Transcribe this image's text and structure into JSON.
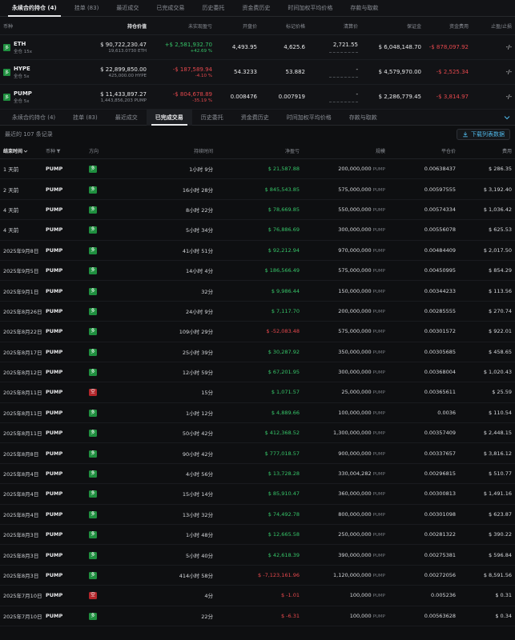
{
  "top_tabs": [
    {
      "label": "永续合约持仓 (4)",
      "active": true
    },
    {
      "label": "挂单 (83)"
    },
    {
      "label": "最近成交"
    },
    {
      "label": "已完成交易"
    },
    {
      "label": "历史委托"
    },
    {
      "label": "资金费历史"
    },
    {
      "label": "时间加权平均价格"
    },
    {
      "label": "存款与取款"
    }
  ],
  "positions": {
    "headers": [
      "币种",
      "持仓价值",
      "未实现盈亏",
      "开盘价",
      "标记价格",
      "清算价",
      "保证金",
      "资金费用",
      "止盈/止损"
    ],
    "rows": [
      {
        "coin": "ETH",
        "mode": "全仓 15x",
        "value": "$ 90,722,230.47",
        "size": "19,613.0730 ETH",
        "pnl": "+$ 2,581,932.70",
        "pnl_pct": "+42.69 %",
        "entry": "4,493.95",
        "mark": "4,625.6",
        "liq": "2,721.55",
        "margin": "$ 6,048,148.70",
        "funding": "-$ 878,097.92",
        "tpsl": "-/-"
      },
      {
        "coin": "HYPE",
        "mode": "全仓 5x",
        "value": "$ 22,899,850.00",
        "size": "425,000.00 HYPE",
        "pnl": "-$ 187,589.94",
        "pnl_pct": "-4.10 %",
        "entry": "54.3233",
        "mark": "53.882",
        "liq": "-",
        "margin": "$ 4,579,970.00",
        "funding": "-$ 2,525.34",
        "tpsl": "-/-"
      },
      {
        "coin": "PUMP",
        "mode": "全仓 5x",
        "value": "$ 11,433,897.27",
        "size": "1,443,856,203 PUMP",
        "pnl": "-$ 804,678.89",
        "pnl_pct": "-35.19 %",
        "entry": "0.008476",
        "mark": "0.007919",
        "liq": "-",
        "margin": "$ 2,286,779.45",
        "funding": "-$ 3,814.97",
        "tpsl": "-/-"
      }
    ]
  },
  "history_tabs": [
    {
      "label": "永续合约持仓 (4)"
    },
    {
      "label": "挂单 (83)"
    },
    {
      "label": "最近成交"
    },
    {
      "label": "已完成交易",
      "active": true
    },
    {
      "label": "历史委托"
    },
    {
      "label": "资金费历史"
    },
    {
      "label": "时间加权平均价格"
    },
    {
      "label": "存款与取款"
    }
  ],
  "history": {
    "count_text": "最近的 107 条记录",
    "download_label": "下载列表数据",
    "headers": [
      "结束时间",
      "币种",
      "方向",
      "持续时间",
      "净盈亏",
      "规模",
      "平仓价",
      "费用"
    ],
    "rows": [
      {
        "time": "1 天前",
        "coin": "PUMP",
        "side": "多",
        "dir": "long",
        "dur": "1小时 9分",
        "pnl": "$ 21,587.88",
        "neg": false,
        "size": "200,000,000",
        "unit": "PUMP",
        "price": "0.00638437",
        "fee": "$ 286.35"
      },
      {
        "time": "2 天前",
        "coin": "PUMP",
        "side": "多",
        "dir": "long",
        "dur": "16小时 28分",
        "pnl": "$ 845,543.85",
        "neg": false,
        "size": "575,000,000",
        "unit": "PUMP",
        "price": "0.00597555",
        "fee": "$ 3,192.40"
      },
      {
        "time": "4 天前",
        "coin": "PUMP",
        "side": "多",
        "dir": "long",
        "dur": "8小时 22分",
        "pnl": "$ 78,669.85",
        "neg": false,
        "size": "550,000,000",
        "unit": "PUMP",
        "price": "0.00574334",
        "fee": "$ 1,036.42"
      },
      {
        "time": "4 天前",
        "coin": "PUMP",
        "side": "多",
        "dir": "long",
        "dur": "5小时 34分",
        "pnl": "$ 76,886.69",
        "neg": false,
        "size": "300,000,000",
        "unit": "PUMP",
        "price": "0.00556078",
        "fee": "$ 625.53"
      },
      {
        "time": "2025年9月8日",
        "coin": "PUMP",
        "side": "多",
        "dir": "long",
        "dur": "41小时 51分",
        "pnl": "$ 92,212.94",
        "neg": false,
        "size": "970,000,000",
        "unit": "PUMP",
        "price": "0.00484409",
        "fee": "$ 2,017.50"
      },
      {
        "time": "2025年9月5日",
        "coin": "PUMP",
        "side": "多",
        "dir": "long",
        "dur": "14小时 4分",
        "pnl": "$ 186,566.49",
        "neg": false,
        "size": "575,000,000",
        "unit": "PUMP",
        "price": "0.00450995",
        "fee": "$ 854.29"
      },
      {
        "time": "2025年9月1日",
        "coin": "PUMP",
        "side": "多",
        "dir": "long",
        "dur": "32分",
        "pnl": "$ 9,986.44",
        "neg": false,
        "size": "150,000,000",
        "unit": "PUMP",
        "price": "0.00344233",
        "fee": "$ 113.56"
      },
      {
        "time": "2025年8月26日",
        "coin": "PUMP",
        "side": "多",
        "dir": "long",
        "dur": "24小时 9分",
        "pnl": "$ 7,117.70",
        "neg": false,
        "size": "200,000,000",
        "unit": "PUMP",
        "price": "0.00285555",
        "fee": "$ 270.74"
      },
      {
        "time": "2025年8月22日",
        "coin": "PUMP",
        "side": "多",
        "dir": "long",
        "dur": "109小时 29分",
        "pnl": "$ -52,083.48",
        "neg": true,
        "size": "575,000,000",
        "unit": "PUMP",
        "price": "0.00301572",
        "fee": "$ 922.01"
      },
      {
        "time": "2025年8月17日",
        "coin": "PUMP",
        "side": "多",
        "dir": "long",
        "dur": "25小时 39分",
        "pnl": "$ 30,287.92",
        "neg": false,
        "size": "350,000,000",
        "unit": "PUMP",
        "price": "0.00305685",
        "fee": "$ 458.65"
      },
      {
        "time": "2025年8月12日",
        "coin": "PUMP",
        "side": "多",
        "dir": "long",
        "dur": "12小时 59分",
        "pnl": "$ 67,201.95",
        "neg": false,
        "size": "300,000,000",
        "unit": "PUMP",
        "price": "0.00368004",
        "fee": "$ 1,020.43"
      },
      {
        "time": "2025年8月11日",
        "coin": "PUMP",
        "side": "空",
        "dir": "short",
        "dur": "15分",
        "pnl": "$ 1,071.57",
        "neg": false,
        "size": "25,000,000",
        "unit": "PUMP",
        "price": "0.00365611",
        "fee": "$ 25.59"
      },
      {
        "time": "2025年8月11日",
        "coin": "PUMP",
        "side": "多",
        "dir": "long",
        "dur": "1小时 12分",
        "pnl": "$ 4,889.66",
        "neg": false,
        "size": "100,000,000",
        "unit": "PUMP",
        "price": "0.0036",
        "fee": "$ 110.54"
      },
      {
        "time": "2025年8月11日",
        "coin": "PUMP",
        "side": "多",
        "dir": "long",
        "dur": "50小时 42分",
        "pnl": "$ 412,368.52",
        "neg": false,
        "size": "1,300,000,000",
        "unit": "PUMP",
        "price": "0.00357409",
        "fee": "$ 2,448.15"
      },
      {
        "time": "2025年8月8日",
        "coin": "PUMP",
        "side": "多",
        "dir": "long",
        "dur": "90小时 42分",
        "pnl": "$ 777,018.57",
        "neg": false,
        "size": "900,000,000",
        "unit": "PUMP",
        "price": "0.00337657",
        "fee": "$ 3,816.12"
      },
      {
        "time": "2025年8月4日",
        "coin": "PUMP",
        "side": "多",
        "dir": "long",
        "dur": "4小时 56分",
        "pnl": "$ 13,728.28",
        "neg": false,
        "size": "330,004,282",
        "unit": "PUMP",
        "price": "0.00296815",
        "fee": "$ 510.77"
      },
      {
        "time": "2025年8月4日",
        "coin": "PUMP",
        "side": "多",
        "dir": "long",
        "dur": "15小时 14分",
        "pnl": "$ 85,910.47",
        "neg": false,
        "size": "360,000,000",
        "unit": "PUMP",
        "price": "0.00300813",
        "fee": "$ 1,491.16"
      },
      {
        "time": "2025年8月4日",
        "coin": "PUMP",
        "side": "多",
        "dir": "long",
        "dur": "13小时 32分",
        "pnl": "$ 74,492.78",
        "neg": false,
        "size": "800,000,000",
        "unit": "PUMP",
        "price": "0.00301098",
        "fee": "$ 623.87"
      },
      {
        "time": "2025年8月3日",
        "coin": "PUMP",
        "side": "多",
        "dir": "long",
        "dur": "1小时 48分",
        "pnl": "$ 12,665.58",
        "neg": false,
        "size": "250,000,000",
        "unit": "PUMP",
        "price": "0.00281322",
        "fee": "$ 390.22"
      },
      {
        "time": "2025年8月3日",
        "coin": "PUMP",
        "side": "多",
        "dir": "long",
        "dur": "5小时 40分",
        "pnl": "$ 42,618.39",
        "neg": false,
        "size": "390,000,000",
        "unit": "PUMP",
        "price": "0.00275381",
        "fee": "$ 596.84"
      },
      {
        "time": "2025年8月3日",
        "coin": "PUMP",
        "side": "多",
        "dir": "long",
        "dur": "414小时 58分",
        "pnl": "$ -7,123,161.96",
        "neg": true,
        "size": "1,120,000,000",
        "unit": "PUMP",
        "price": "0.00272056",
        "fee": "$ 8,591.56"
      },
      {
        "time": "2025年7月10日",
        "coin": "PUMP",
        "side": "空",
        "dir": "short",
        "dur": "4分",
        "pnl": "$ -1.01",
        "neg": true,
        "size": "100,000",
        "unit": "PUMP",
        "price": "0.005236",
        "fee": "$ 0.31"
      },
      {
        "time": "2025年7月10日",
        "coin": "PUMP",
        "side": "多",
        "dir": "long",
        "dur": "22分",
        "pnl": "$ -6.31",
        "neg": true,
        "size": "100,000",
        "unit": "PUMP",
        "price": "0.00563628",
        "fee": "$ 0.34"
      }
    ]
  }
}
